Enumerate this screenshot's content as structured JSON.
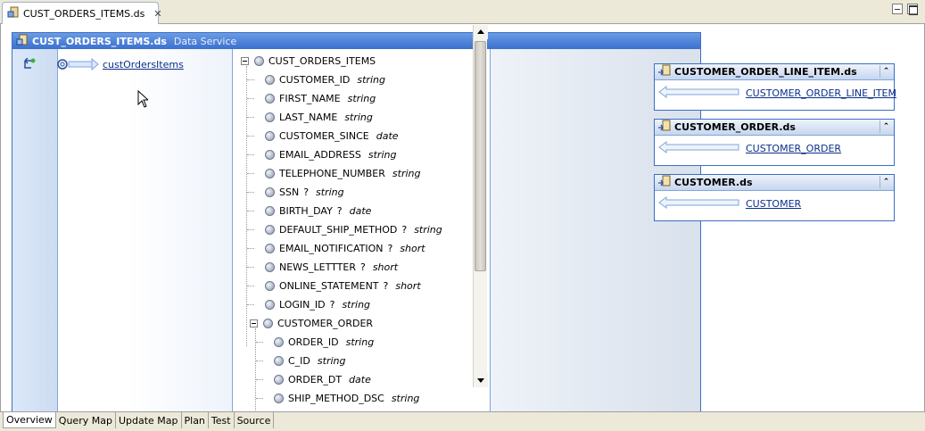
{
  "editor": {
    "tab_title": "CUST_ORDERS_ITEMS.ds",
    "tab_icon": "data-service-icon"
  },
  "service": {
    "title": "CUST_ORDERS_ITEMS.ds",
    "subtitle": "Data Service",
    "operation": "custOrdersItems"
  },
  "tree": {
    "root": "CUST_ORDERS_ITEMS",
    "fields": [
      {
        "name": "CUSTOMER_ID",
        "opt": "",
        "type": "string"
      },
      {
        "name": "FIRST_NAME",
        "opt": "",
        "type": "string"
      },
      {
        "name": "LAST_NAME",
        "opt": "",
        "type": "string"
      },
      {
        "name": "CUSTOMER_SINCE",
        "opt": "",
        "type": "date"
      },
      {
        "name": "EMAIL_ADDRESS",
        "opt": "",
        "type": "string"
      },
      {
        "name": "TELEPHONE_NUMBER",
        "opt": "",
        "type": "string"
      },
      {
        "name": "SSN",
        "opt": "?",
        "type": "string"
      },
      {
        "name": "BIRTH_DAY",
        "opt": "?",
        "type": "date"
      },
      {
        "name": "DEFAULT_SHIP_METHOD",
        "opt": "?",
        "type": "string"
      },
      {
        "name": "EMAIL_NOTIFICATION",
        "opt": "?",
        "type": "short"
      },
      {
        "name": "NEWS_LETTTER",
        "opt": "?",
        "type": "short"
      },
      {
        "name": "ONLINE_STATEMENT",
        "opt": "?",
        "type": "short"
      },
      {
        "name": "LOGIN_ID",
        "opt": "?",
        "type": "string"
      }
    ],
    "child_group": "CUSTOMER_ORDER",
    "child_fields": [
      {
        "name": "ORDER_ID",
        "opt": "",
        "type": "string"
      },
      {
        "name": "C_ID",
        "opt": "",
        "type": "string"
      },
      {
        "name": "ORDER_DT",
        "opt": "",
        "type": "date"
      },
      {
        "name": "SHIP_METHOD_DSC",
        "opt": "",
        "type": "string"
      }
    ]
  },
  "dependencies": [
    {
      "title": "CUSTOMER_ORDER_LINE_ITEM.ds",
      "link": "CUSTOMER_ORDER_LINE_ITEM"
    },
    {
      "title": "CUSTOMER_ORDER.ds",
      "link": "CUSTOMER_ORDER"
    },
    {
      "title": "CUSTOMER.ds",
      "link": "CUSTOMER"
    }
  ],
  "bottom_tabs": [
    {
      "label": "Overview",
      "active": true
    },
    {
      "label": "Query Map",
      "active": false
    },
    {
      "label": "Update Map",
      "active": false
    },
    {
      "label": "Plan",
      "active": false
    },
    {
      "label": "Test",
      "active": false
    },
    {
      "label": "Source",
      "active": false
    }
  ],
  "colors": {
    "header_blue": "#3a70cf",
    "link_blue": "#0b2f8a",
    "tab_bar": "#ece9d8"
  }
}
